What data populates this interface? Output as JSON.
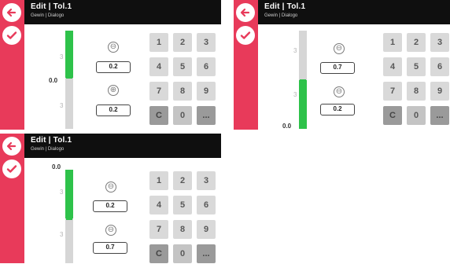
{
  "panels": [
    {
      "header": {
        "title": "Edit | Tol.1",
        "subtitle": "Gewin | Dialogo"
      },
      "slider": {
        "value_label": "0.0",
        "marker_top": "3",
        "marker_bottom": "3",
        "fill_fraction": 0.48,
        "fill_from": "top"
      },
      "upper": {
        "sign": "⊖",
        "value": "0.2"
      },
      "lower": {
        "sign": "⊕",
        "value": "0.2"
      }
    },
    {
      "header": {
        "title": "Edit | Tol.1",
        "subtitle": "Gewin | Dialogo"
      },
      "slider": {
        "value_label": "0.0",
        "marker_top": "3",
        "marker_bottom": "3",
        "fill_fraction": 0.45,
        "fill_from": "bottom"
      },
      "upper": {
        "sign": "⊖",
        "value": "0.7"
      },
      "lower": {
        "sign": "⊖",
        "value": "0.2"
      }
    },
    {
      "header": {
        "title": "Edit | Tol.1",
        "subtitle": "Gewin | Dialogo"
      },
      "slider": {
        "value_label": "0.0",
        "marker_top": "3",
        "marker_bottom": "3",
        "fill_fraction": 0.45,
        "fill_from": "top"
      },
      "upper": {
        "sign": "⊖",
        "value": "0.2"
      },
      "lower": {
        "sign": "⊖",
        "value": "0.7"
      }
    }
  ],
  "keypad": [
    "1",
    "2",
    "3",
    "4",
    "5",
    "6",
    "7",
    "8",
    "9",
    "C",
    "0",
    "..."
  ],
  "colors": {
    "accent_red": "#e83a5a",
    "green": "#2ec24a",
    "header": "#0f0f0f"
  },
  "icons": {
    "back": "back-arrow-icon",
    "confirm": "checkmark-icon"
  }
}
